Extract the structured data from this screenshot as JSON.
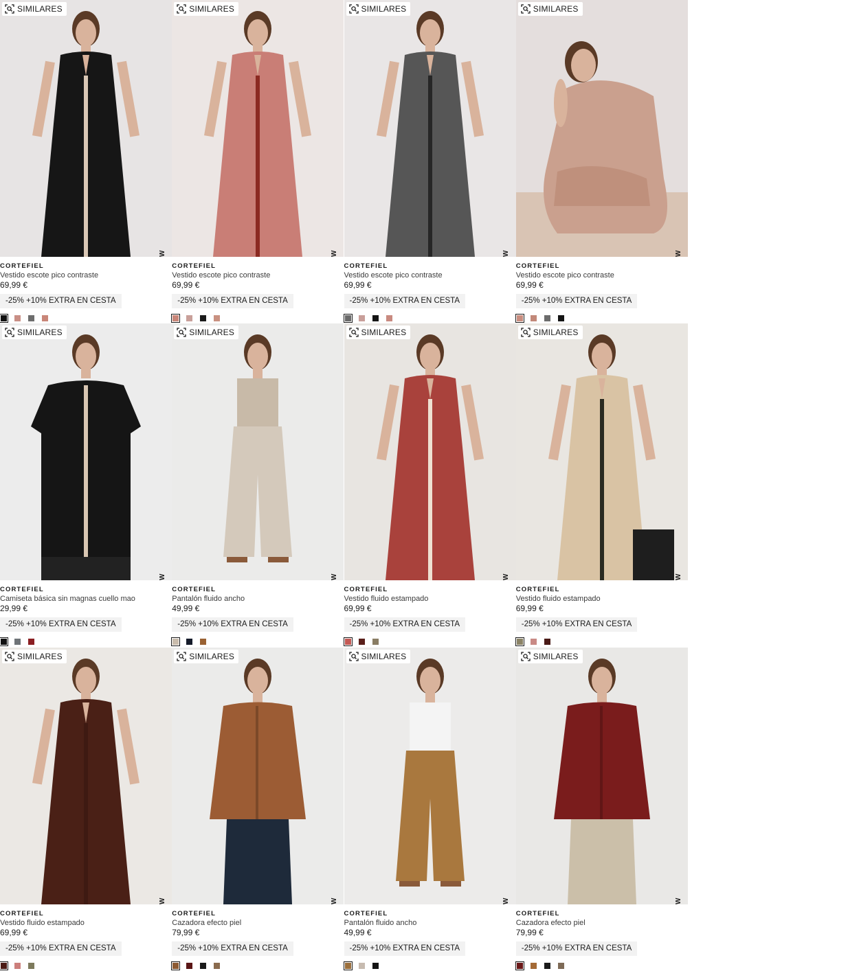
{
  "similares_label": "SIMILARES",
  "new_label": "NEW",
  "products": [
    {
      "brand": "CORTEFIEL",
      "name": "Vestido escote pico contraste",
      "price": "69,99 €",
      "promo": "-25% +10% EXTRA EN CESTA",
      "bg": "#e7e4e4",
      "garment": "dress",
      "main": "#161616",
      "accent": "#d9c7b5",
      "swatches": [
        "#111111",
        "#c98f86",
        "#6d6d6d",
        "#c98679"
      ]
    },
    {
      "brand": "CORTEFIEL",
      "name": "Vestido escote pico contraste",
      "price": "69,99 €",
      "promo": "-25% +10% EXTRA EN CESTA",
      "bg": "#ece6e4",
      "garment": "dress",
      "main": "#c97e76",
      "accent": "#8b2a22",
      "swatches": [
        "#c98679",
        "#c9a09a",
        "#1a1a1a",
        "#c99181"
      ]
    },
    {
      "brand": "CORTEFIEL",
      "name": "Vestido escote pico contraste",
      "price": "69,99 €",
      "promo": "-25% +10% EXTRA EN CESTA",
      "bg": "#e9e6e6",
      "garment": "dress",
      "main": "#565656",
      "accent": "#262626",
      "swatches": [
        "#6a6a6a",
        "#c99f9a",
        "#151515",
        "#c98a80"
      ]
    },
    {
      "brand": "CORTEFIEL",
      "name": "Vestido escote pico contraste",
      "price": "69,99 €",
      "promo": "-25% +10% EXTRA EN CESTA",
      "bg": "#e4dedd",
      "garment": "crouch",
      "main": "#caa08e",
      "accent": "#b8866f",
      "swatches": [
        "#c98d7f",
        "#c28879",
        "#6c6c6c",
        "#141414"
      ]
    },
    {
      "brand": "CORTEFIEL",
      "name": "Camiseta básica sin magnas cuello mao",
      "price": "29,99 €",
      "promo": "-25% +10% EXTRA EN CESTA",
      "bg": "#ececec",
      "garment": "top",
      "main": "#151515",
      "accent": "#d8c6b2",
      "swatches": [
        "#111111",
        "#6f7478",
        "#8b1f22"
      ]
    },
    {
      "brand": "CORTEFIEL",
      "name": "Pantalón fluido ancho",
      "price": "49,99 €",
      "promo": "-25% +10% EXTRA EN CESTA",
      "bg": "#ebebea",
      "garment": "pants",
      "main": "#d4c9bb",
      "accent": "#c8baa8",
      "swatches": [
        "#c9bcac",
        "#151b2a",
        "#9a6233"
      ]
    },
    {
      "brand": "CORTEFIEL",
      "name": "Vestido fluido estampado",
      "price": "69,99 €",
      "promo": "-25% +10% EXTRA EN CESTA",
      "bg": "#e8e5e1",
      "garment": "dress",
      "main": "#a9423c",
      "accent": "#efe1d2",
      "swatches": [
        "#c45a55",
        "#5a1f1a",
        "#8a7d64"
      ]
    },
    {
      "brand": "CORTEFIEL",
      "name": "Vestido fluido estampado",
      "price": "69,99 €",
      "promo": "-25% +10% EXTRA EN CESTA",
      "bg": "#e9e6e1",
      "garment": "seated",
      "main": "#d9c3a4",
      "accent": "#2a2a20",
      "swatches": [
        "#8b8366",
        "#c98a85",
        "#4a1a16"
      ]
    },
    {
      "brand": "CORTEFIEL",
      "name": "Vestido fluido estampado",
      "price": "69,99 €",
      "promo": "-25% +10% EXTRA EN CESTA",
      "bg": "#ebe8e4",
      "garment": "dress",
      "main": "#4a2016",
      "accent": "#3e1a12",
      "swatches": [
        "#4a1a14",
        "#cc7f7c",
        "#7d7a5c"
      ]
    },
    {
      "brand": "CORTEFIEL",
      "name": "Cazadora efecto piel",
      "price": "79,99 €",
      "promo": "-25% +10% EXTRA EN CESTA",
      "bg": "#ebebea",
      "garment": "jacket",
      "main": "#9c5c34",
      "accent": "#1e2a3a",
      "swatches": [
        "#8d5a33",
        "#5a1616",
        "#1a1a1a",
        "#8a6b4e"
      ]
    },
    {
      "brand": "CORTEFIEL",
      "name": "Pantalón fluido ancho",
      "price": "49,99 €",
      "promo": "-25% +10% EXTRA EN CESTA",
      "bg": "#ecebea",
      "garment": "pants",
      "main": "#a9783e",
      "accent": "#f4f4f4",
      "swatches": [
        "#9b6f3c",
        "#c7bbb0",
        "#151515"
      ]
    },
    {
      "brand": "CORTEFIEL",
      "name": "Cazadora efecto piel",
      "price": "79,99 €",
      "promo": "-25% +10% EXTRA EN CESTA",
      "bg": "#e9e8e6",
      "garment": "jacket",
      "main": "#7a1c1c",
      "accent": "#cbbfa9",
      "swatches": [
        "#6a1818",
        "#a46a36",
        "#1a1a1a",
        "#7e6a56"
      ]
    }
  ]
}
